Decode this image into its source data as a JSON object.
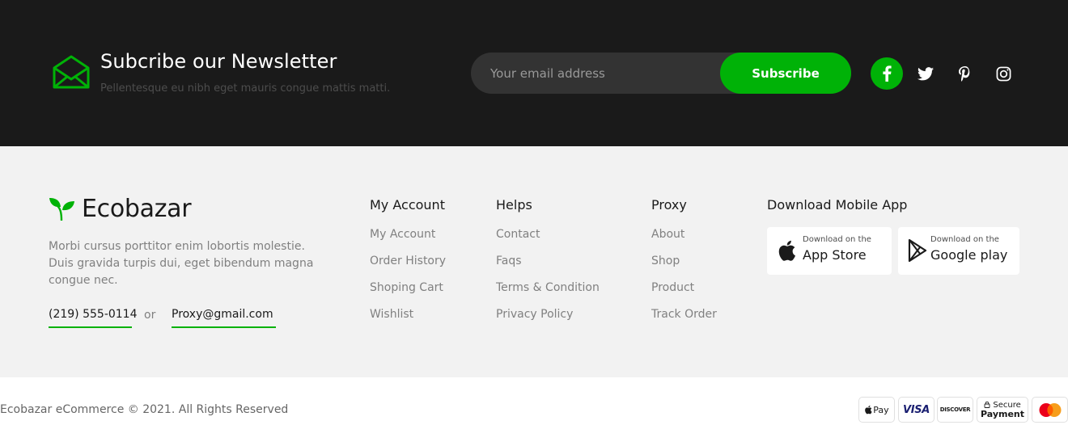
{
  "colors": {
    "accent": "#00b207",
    "newsletter_bg": "#1a1a1a",
    "footer_bg": "#f2f2f2",
    "text_dark": "#1a1a1a",
    "text_muted": "#808080"
  },
  "newsletter": {
    "icon": "envelope-icon",
    "title": "Subcribe our Newsletter",
    "subtitle": "Pellentesque eu nibh eget mauris congue mattis matti.",
    "email_placeholder": "Your email address",
    "subscribe_label": "Subscribe",
    "social": [
      "facebook-icon",
      "twitter-icon",
      "pinterest-icon",
      "instagram-icon"
    ]
  },
  "brand": {
    "logo_icon": "leaf-icon",
    "name": "Ecobazar",
    "description": "Morbi cursus porttitor enim lobortis molestie. Duis gravida turpis dui, eget bibendum magna congue nec.",
    "phone": "(219) 555-0114",
    "or": "or",
    "email": "Proxy@gmail.com"
  },
  "columns": [
    {
      "title": "My Account",
      "links": [
        "My Account",
        "Order History",
        "Shoping Cart",
        "Wishlist"
      ]
    },
    {
      "title": "Helps",
      "links": [
        "Contact",
        "Faqs",
        "Terms & Condition",
        "Privacy Policy"
      ]
    },
    {
      "title": "Proxy",
      "links": [
        "About",
        "Shop",
        "Product",
        "Track Order"
      ]
    }
  ],
  "app": {
    "title": "Download Mobile App",
    "apple": {
      "icon": "apple-icon",
      "small": "Download on the",
      "big": "App Store"
    },
    "google": {
      "icon": "google-play-icon",
      "small": "Download on the",
      "big": "Google play"
    }
  },
  "bottom": {
    "copyright": "Ecobazar eCommerce © 2021. All Rights Reserved",
    "payments": {
      "apple_pay": "Pay",
      "visa": "VISA",
      "discover": "DISCOVER",
      "secure_top": "Secure",
      "secure_bottom": "Payment",
      "mastercard": "mastercard-icon"
    }
  }
}
